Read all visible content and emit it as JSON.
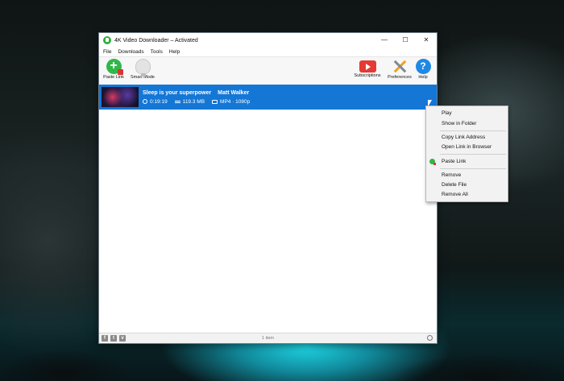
{
  "window": {
    "title": "4K Video Downloader – Activated",
    "controls": {
      "minimize": "—",
      "maximize": "☐",
      "close": "✕"
    }
  },
  "menu": [
    "File",
    "Downloads",
    "Tools",
    "Help"
  ],
  "toolbar": {
    "paste_link": "Paste Link",
    "smart_mode": "Smart Mode",
    "subscriptions": "Subscriptions",
    "preferences": "Preferences",
    "help": "Help",
    "help_glyph": "?"
  },
  "download": {
    "title": "Sleep is your superpower",
    "author": "Matt Walker",
    "duration": "0:19:19",
    "size": "119.3 MB",
    "format": "MP4 · 1080p"
  },
  "status": {
    "count": "1 item",
    "social": [
      "f",
      "t",
      "v"
    ]
  },
  "context_menu": {
    "play": "Play",
    "show_in_folder": "Show in Folder",
    "copy_link_address": "Copy Link Address",
    "open_link_in_browser": "Open Link in Browser",
    "paste_link": "Paste Link",
    "remove": "Remove",
    "delete_file": "Delete File",
    "remove_all": "Remove All"
  },
  "colors": {
    "selection": "#1477d6",
    "accent_green": "#30b748",
    "subscriptions_red": "#e53935",
    "help_blue": "#1e88e5"
  }
}
